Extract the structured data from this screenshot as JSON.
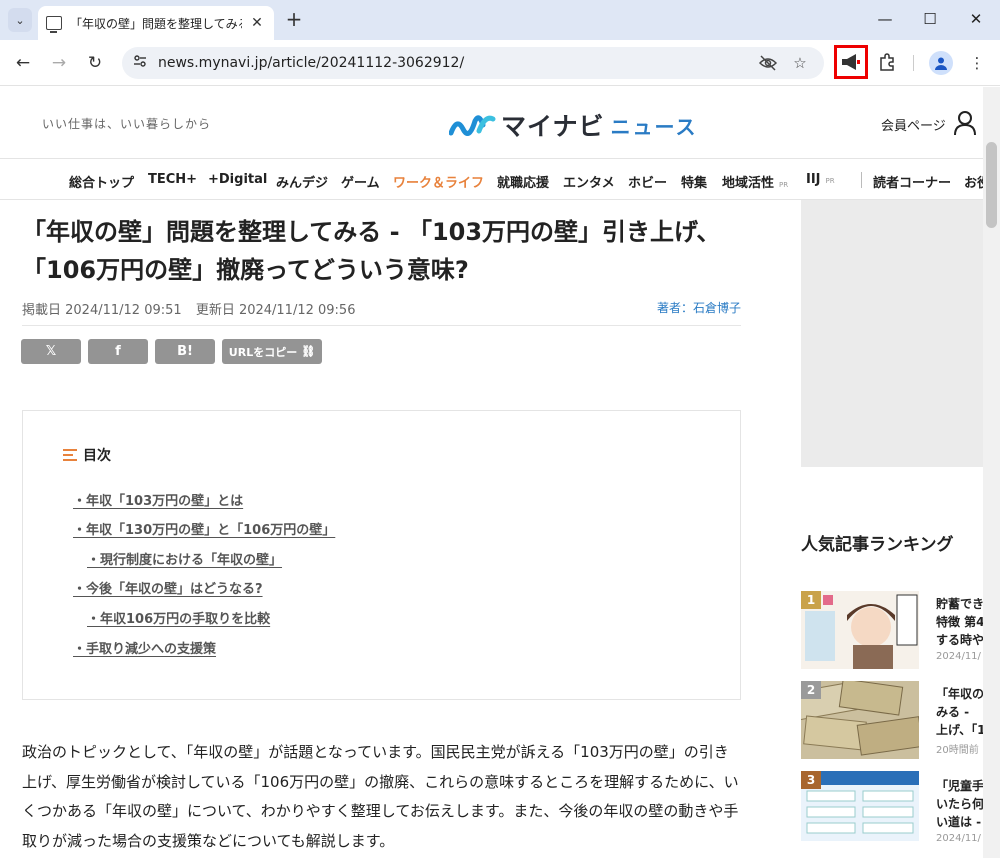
{
  "browser": {
    "tab_title": "「年収の壁」問題を整理してみる - 「103万円の壁」引き上げ",
    "url": "news.mynavi.jp/article/20241112-3062912/",
    "win_min": "—",
    "win_max": "☐",
    "win_close": "✕",
    "new_tab": "+",
    "tab_close": "✕"
  },
  "header": {
    "tagline": "いい仕事は、いい暮らしから",
    "logo_main": "マイナビ",
    "logo_news": "ニュース",
    "member_label": "会員ページ"
  },
  "nav": {
    "items": [
      "総合トップ",
      "TECH+",
      "+Digital",
      "みんデジ",
      "ゲーム",
      "ワーク＆ライフ",
      "就職応援",
      "エンタメ",
      "ホビー",
      "特集",
      "地域活性",
      "IIJ",
      "読者コーナー",
      "お役"
    ],
    "pr": "PR",
    "active_index": 5,
    "active_color": "#e8823c"
  },
  "article": {
    "title": "「年収の壁」問題を整理してみる - 「103万円の壁」引き上げ、「106万円の壁」撤廃ってどういう意味?",
    "published": "掲載日 2024/11/12 09:51",
    "updated": "更新日 2024/11/12 09:56",
    "author": "著者：石倉博子",
    "share": {
      "x": "𝕏",
      "facebook": "f",
      "hatena": "B!",
      "copy_url": "URLをコピー"
    },
    "toc_label": "目次",
    "toc": [
      "・年収「103万円の壁」とは",
      "・年収「130万円の壁」と「106万円の壁」",
      "・現行制度における「年収の壁」",
      "・今後「年収の壁」はどうなる?",
      "・年収106万円の手取りを比較",
      "・手取り減少への支援策"
    ],
    "body": "政治のトピックとして、「年収の壁」が話題となっています。国民民主党が訴える「103万円の壁」の引き上げ、厚生労働省が検討している「106万円の壁」の撤廃、これらの意味するところを理解するために、いくつかある「年収の壁」について、わかりやすく整理してお伝えします。また、今後の年収の壁の動きや手取りが減った場合の支援策などについても解説します。"
  },
  "sidebar": {
    "ranking_title": "人気記事ランキング",
    "items": [
      {
        "rank": "1",
        "text": "貯蓄でき\n特徴 第4\nする時や",
        "date": "2024/11/"
      },
      {
        "rank": "2",
        "text": "「年収の\nみる -\n上げ、「1",
        "date": "20時間前"
      },
      {
        "rank": "3",
        "text": "「児童手\nいたら何\nい道は -",
        "date": "2024/11/"
      }
    ]
  }
}
